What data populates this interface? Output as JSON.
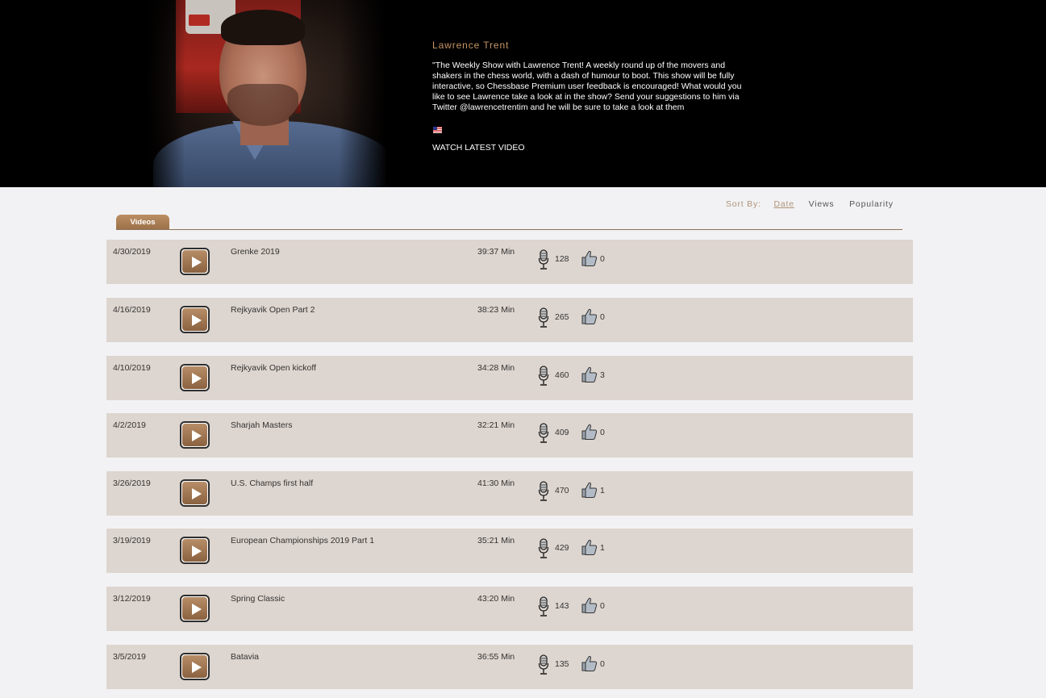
{
  "author": {
    "name": "Lawrence Trent",
    "description": "\"The Weekly Show with Lawrence Trent! A weekly round up of the movers and shakers in the chess world, with a dash of humour to boot. This show will be fully interactive, so Chessbase Premium user feedback is encouraged! What would you like to see Lawrence take a look at in the show? Send your suggestions to him via Twitter @lawrencetrentim and he will be sure to take a look at them",
    "flag_icon": "us-flag-icon",
    "watch_latest_label": "WATCH LATEST VIDEO"
  },
  "sort": {
    "label": "Sort By:",
    "options": [
      "Date",
      "Views",
      "Popularity"
    ],
    "selected": "Date"
  },
  "tab": {
    "label": "Videos"
  },
  "videos": [
    {
      "date": "4/30/2019",
      "title": "Grenke 2019",
      "duration": "39:37 Min",
      "views": "128",
      "likes": "0"
    },
    {
      "date": "4/16/2019",
      "title": "Rejkyavik Open Part 2",
      "duration": "38:23 Min",
      "views": "265",
      "likes": "0"
    },
    {
      "date": "4/10/2019",
      "title": "Rejkyavik Open kickoff",
      "duration": "34:28 Min",
      "views": "460",
      "likes": "3"
    },
    {
      "date": "4/2/2019",
      "title": "Sharjah Masters",
      "duration": "32:21 Min",
      "views": "409",
      "likes": "0"
    },
    {
      "date": "3/26/2019",
      "title": "U.S. Champs first half",
      "duration": "41:30 Min",
      "views": "470",
      "likes": "1"
    },
    {
      "date": "3/19/2019",
      "title": "European Championships 2019 Part 1",
      "duration": "35:21 Min",
      "views": "429",
      "likes": "1"
    },
    {
      "date": "3/12/2019",
      "title": "Spring Classic",
      "duration": "43:20 Min",
      "views": "143",
      "likes": "0"
    },
    {
      "date": "3/5/2019",
      "title": "Batavia",
      "duration": "36:55 Min",
      "views": "135",
      "likes": "0"
    }
  ],
  "icons": {
    "play": "play-icon",
    "views": "microphone-icon",
    "likes": "thumbs-up-icon"
  }
}
